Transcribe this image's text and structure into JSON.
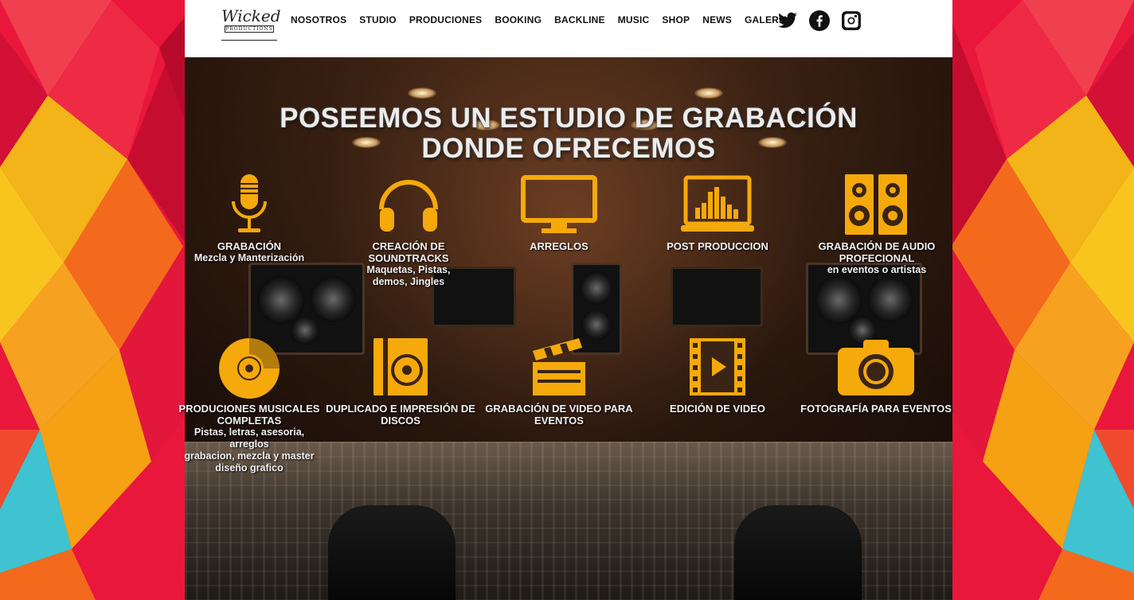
{
  "logo": {
    "script": "Wicked",
    "sub": "PRODUCTIONS"
  },
  "nav": {
    "items": [
      "NOSOTROS",
      "STUDIO",
      "PRODUCIONES",
      "BOOKING",
      "BACKLINE",
      "MUSIC",
      "SHOP",
      "NEWS",
      "GALERIA"
    ]
  },
  "social": {
    "icons": [
      "twitter-icon",
      "facebook-icon",
      "instagram-icon"
    ]
  },
  "headline": {
    "line1": "POSEEMOS UN ESTUDIO DE GRABACIÓN",
    "line2": "DONDE OFRECEMOS"
  },
  "colors": {
    "accent": "#f5a90b",
    "sideRed": "#e8173b",
    "sideYellow": "#f2b418",
    "sideOrange": "#f36a1d",
    "sideCyan": "#3fc3d1"
  },
  "services": [
    {
      "icon": "microphone-icon",
      "title": "GRABACIÓN",
      "desc": "Mezcla y Manterización"
    },
    {
      "icon": "headphones-icon",
      "title": "CREACIÓN DE SOUNDTRACKS",
      "desc": "Maquetas, Pistas,\ndemos, Jingles"
    },
    {
      "icon": "monitor-icon",
      "title": "ARREGLOS",
      "desc": ""
    },
    {
      "icon": "laptop-equalizer-icon",
      "title": "POST PRODUCCION",
      "desc": ""
    },
    {
      "icon": "speakers-icon",
      "title": "GRABACIÓN DE AUDIO PROFECIONAL",
      "desc": "en eventos o artistas"
    },
    {
      "icon": "cd-icon",
      "title": "PRODUCIONES MUSICALES COMPLETAS",
      "desc": "Pistas, letras, asesoria,\narreglos\ngrabacion, mezcla y master\ndiseño grafico"
    },
    {
      "icon": "disc-case-icon",
      "title": "DUPLICADO E IMPRESIÓN DE DISCOS",
      "desc": ""
    },
    {
      "icon": "clapperboard-icon",
      "title": "GRABACIÓN DE VIDEO PARA EVENTOS",
      "desc": ""
    },
    {
      "icon": "film-play-icon",
      "title": "EDICIÓN DE VIDEO",
      "desc": ""
    },
    {
      "icon": "camera-icon",
      "title": "FOTOGRAFÍA PARA EVENTOS",
      "desc": ""
    }
  ]
}
